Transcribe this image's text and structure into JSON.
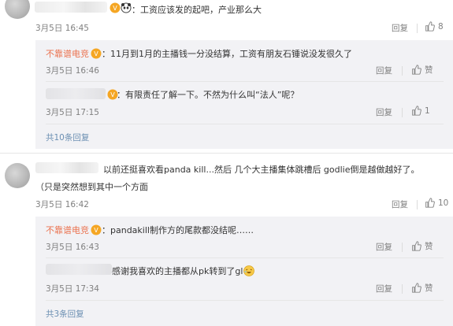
{
  "comments": [
    {
      "text": "：工资应该发的起吧，产业那么大",
      "time": "3月5日 16:45",
      "reply_label": "回复",
      "like_count": "8"
    },
    {
      "text": "以前还挺喜欢看panda kill...然后 几个大主播集体跳槽后 godlie倒是越做越好了。",
      "text_line2": "（只是突然想到其中一个方面",
      "time": "3月5日 16:42",
      "reply_label": "回复",
      "like_count": "10"
    }
  ],
  "reply_groups": [
    {
      "replies": [
        {
          "username": "不靠谱电竞",
          "text": "：11月到1月的主播钱一分没结算，工资有朋友石锤说没发很久了",
          "time": "3月5日 16:46",
          "reply_label": "回复",
          "like_label": "赞"
        },
        {
          "text": "：有限责任了解一下。不然为什么叫“法人”呢？",
          "time": "3月5日 17:15",
          "reply_label": "回复",
          "like_count": "1"
        }
      ],
      "more_label": "共10条回复"
    },
    {
      "replies": [
        {
          "username": "不靠谱电竞",
          "text": "：pandakill制作方的尾款都没结呢……",
          "time": "3月5日 16:43",
          "reply_label": "回复",
          "like_label": "赞"
        },
        {
          "text": "感谢我喜欢的主播都从pk转到了gl",
          "time": "3月5日 17:34",
          "reply_label": "回复",
          "like_label": "赞"
        }
      ],
      "more_label": "共3条回复"
    }
  ],
  "colors": {
    "username": "#eb7350",
    "more_link": "#6b8fb2",
    "meta": "#808080",
    "reply_bg": "#f2f2f5"
  },
  "icons": {
    "like": "thumbs-up-icon",
    "vip": "vip-badge-icon",
    "emoji": "panda-emoji-icon"
  }
}
